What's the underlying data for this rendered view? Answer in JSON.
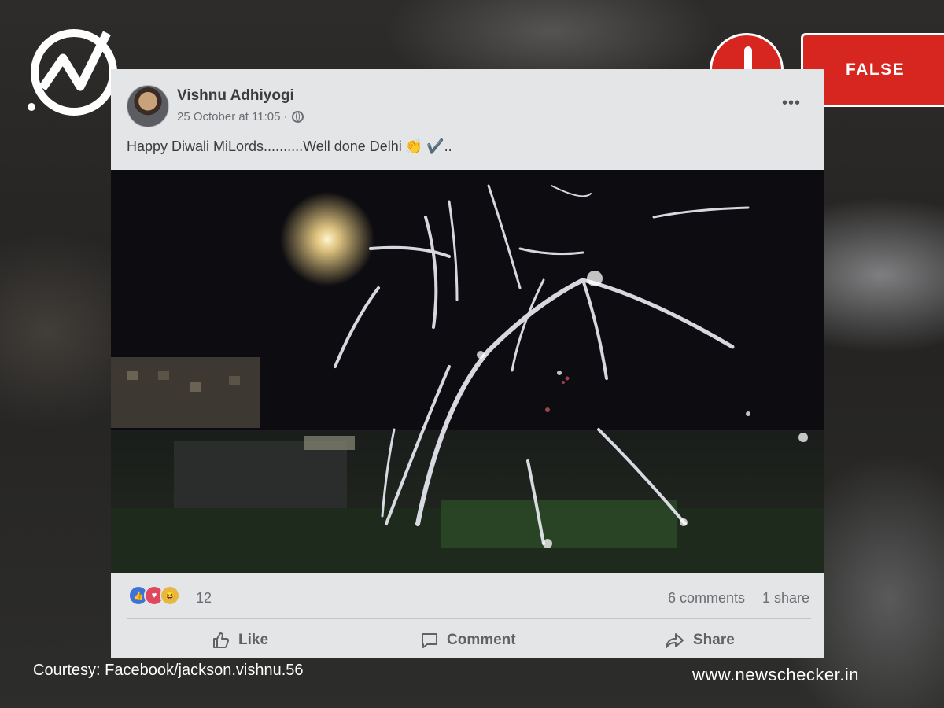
{
  "badge": {
    "verdict_label": "FALSE",
    "alert_icon": "exclamation-icon",
    "color": "#d7261f"
  },
  "post": {
    "author": "Vishnu Adhiyogi",
    "timestamp": "25 October at 11:05 ·",
    "privacy_icon": "globe-icon",
    "text": "Happy Diwali MiLords..........Well done Delhi",
    "emojis": "👏 ✔️..",
    "reaction_count": "12",
    "comments": "6 comments",
    "shares": "1 share",
    "actions": {
      "like": "Like",
      "comment": "Comment",
      "share": "Share"
    }
  },
  "footer": {
    "courtesy": "Courtesy: Facebook/jackson.vishnu.56",
    "site": "www.newschecker.in"
  }
}
